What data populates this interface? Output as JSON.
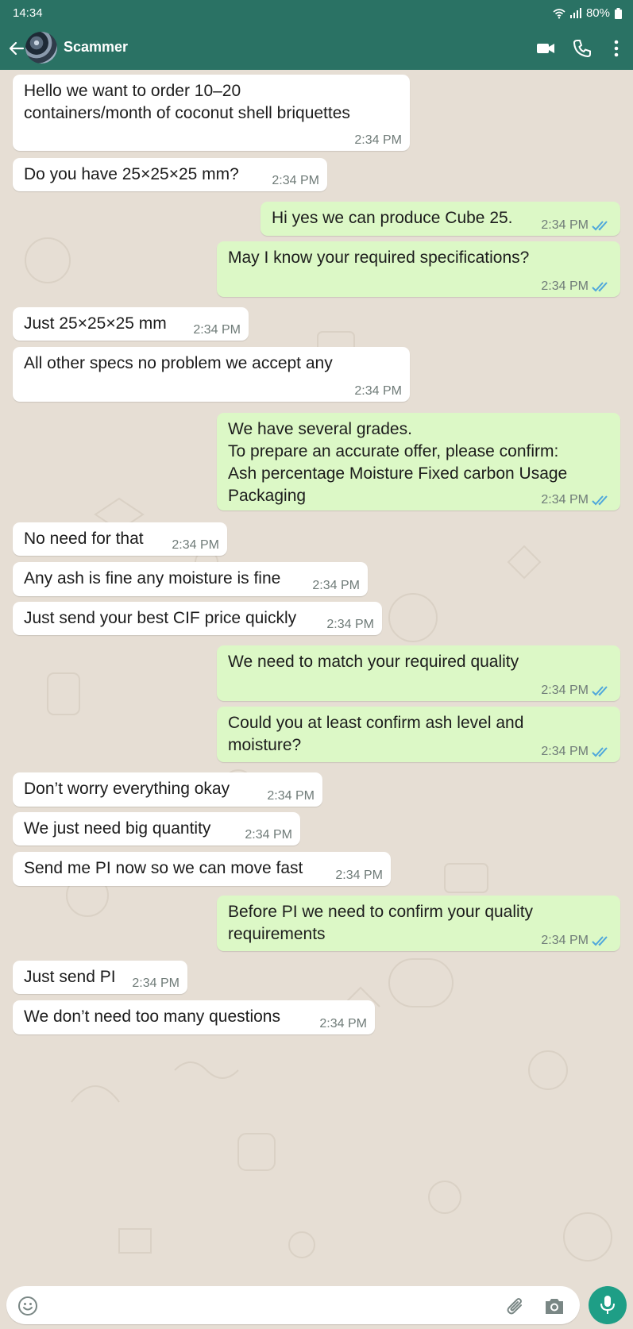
{
  "status_bar": {
    "time": "14:34",
    "battery": "80%"
  },
  "header": {
    "contact_name": "Scammer"
  },
  "messages": [
    {
      "text": "Hello we want to order 10–20\ncontainers/month of coconut shell briquettes",
      "time": "2:34 PM",
      "direction": "incoming"
    },
    {
      "text": "Do you have 25×25×25 mm?",
      "time": "2:34 PM",
      "direction": "incoming"
    },
    {
      "text": "Hi yes we can produce Cube 25.",
      "time": "2:34 PM",
      "direction": "outgoing",
      "status": "read"
    },
    {
      "text": "May I know your required specifications?",
      "time": "2:34 PM",
      "direction": "outgoing",
      "status": "read"
    },
    {
      "text": "Just 25×25×25 mm",
      "time": "2:34 PM",
      "direction": "incoming"
    },
    {
      "text": "All other specs no problem we accept any",
      "time": "2:34 PM",
      "direction": "incoming"
    },
    {
      "text": "We have several grades.\nTo prepare an accurate offer, please confirm:\nAsh percentage Moisture Fixed carbon Usage\nPackaging",
      "time": "2:34 PM",
      "direction": "outgoing",
      "status": "read"
    },
    {
      "text": "No need for that",
      "time": "2:34 PM",
      "direction": "incoming"
    },
    {
      "text": "Any ash is fine any moisture is fine",
      "time": "2:34 PM",
      "direction": "incoming"
    },
    {
      "text": "Just send your best CIF price quickly",
      "time": "2:34 PM",
      "direction": "incoming"
    },
    {
      "text": "We need to match your required quality",
      "time": "2:34 PM",
      "direction": "outgoing",
      "status": "read"
    },
    {
      "text": "Could you at least confirm ash level and\nmoisture?",
      "time": "2:34 PM",
      "direction": "outgoing",
      "status": "read"
    },
    {
      "text": "Don’t worry everything okay",
      "time": "2:34 PM",
      "direction": "incoming"
    },
    {
      "text": "We just need big quantity",
      "time": "2:34 PM",
      "direction": "incoming"
    },
    {
      "text": "Send me PI now so we can move fast",
      "time": "2:34 PM",
      "direction": "incoming"
    },
    {
      "text": "Before PI we need to confirm your quality\nrequirements",
      "time": "2:34 PM",
      "direction": "outgoing",
      "status": "read"
    },
    {
      "text": "Just send PI",
      "time": "2:34 PM",
      "direction": "incoming"
    },
    {
      "text": "We don’t need too many questions",
      "time": "2:34 PM",
      "direction": "incoming"
    }
  ],
  "input": {
    "placeholder": ""
  },
  "colors": {
    "header": "#2a7264",
    "incoming_bubble": "#ffffff",
    "outgoing_bubble": "#dcf8c6",
    "chat_background": "#e6ded4",
    "read_ticks": "#4fa7db",
    "mic_button": "#1e9e86"
  },
  "icons": {
    "header": [
      "back-arrow-icon",
      "video-call-icon",
      "phone-icon",
      "more-options-icon"
    ],
    "input": [
      "emoji-icon",
      "attach-icon",
      "camera-icon",
      "mic-icon"
    ],
    "status": [
      "wifi-icon",
      "signal-icon",
      "battery-icon"
    ]
  }
}
